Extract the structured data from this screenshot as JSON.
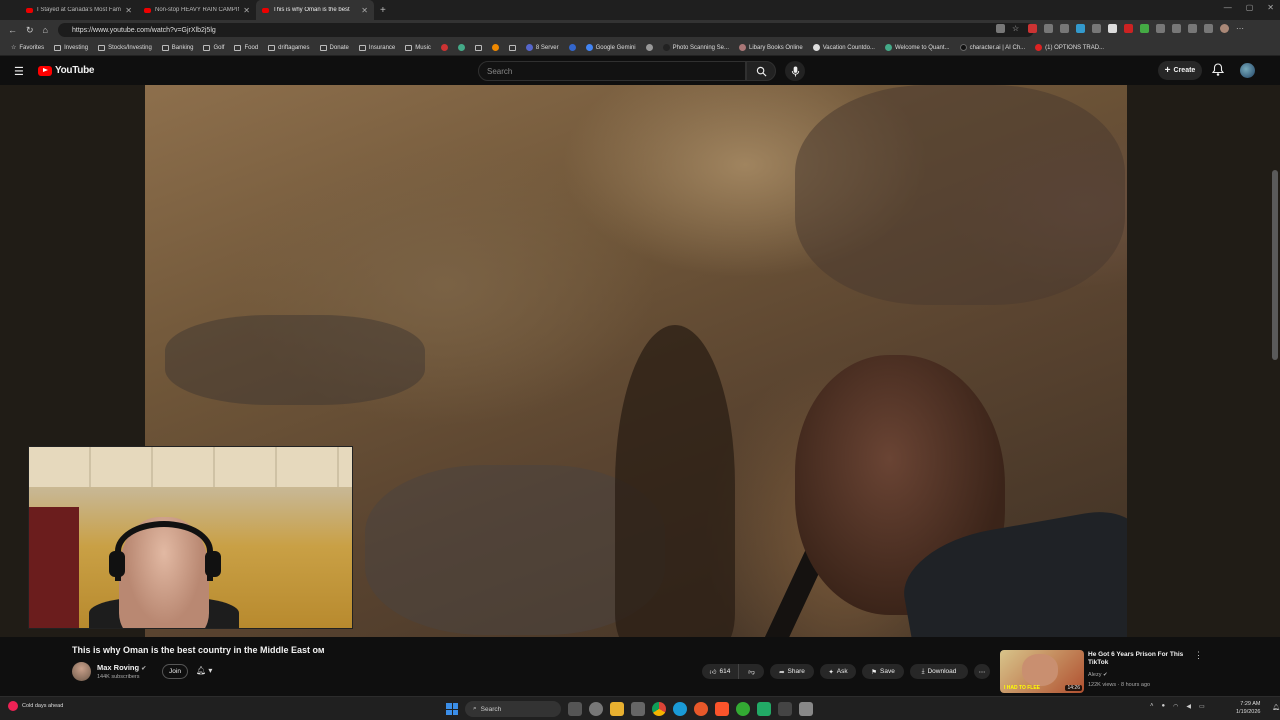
{
  "browser": {
    "tabs": [
      {
        "label": "I Stayed at Canada's Most Famou"
      },
      {
        "label": "Non-stop HEAVY RAIN CAMPING"
      },
      {
        "label": "This is why Oman is the best"
      }
    ],
    "url": "https://www.youtube.com/watch?v=GjrXlb2j5lg",
    "bookmarks": [
      "Favorites",
      "Investing",
      "Stocks/Investing",
      "Banking",
      "Golf",
      "Food",
      "driftagames",
      "Donate",
      "Insurance",
      "Music",
      "8 Server",
      "Google Gemini",
      "Photo Scanning Se...",
      "Libary Books Online",
      "Vacation Countdo...",
      "Welcome to Quant...",
      "character.ai | AI Ch...",
      "(1) OPTIONS TRAD..."
    ]
  },
  "youtube": {
    "logo": "YouTube",
    "search_placeholder": "Search",
    "create_label": "Create"
  },
  "video": {
    "title": "This is why Oman is the best country in the Middle East ом",
    "channel": "Max Roving",
    "subscribers": "144K subscribers",
    "join_label": "Join",
    "likes": "614",
    "share_label": "Share",
    "ask_label": "Ask",
    "save_label": "Save",
    "download_label": "Download"
  },
  "recommendation": {
    "title": "He Got 6 Years Prison For This TikTok",
    "channel": "Alezy",
    "meta": "122K views · 8 hours ago",
    "duration": "14:26",
    "caption": "I HAD TO FLEE"
  },
  "taskbar": {
    "weather": "Cold days ahead",
    "search": "Search",
    "time": "7:29 AM",
    "date": "1/19/2026"
  },
  "colors": {
    "youtube_red": "#ff0000",
    "bg": "#0f0f0f"
  }
}
